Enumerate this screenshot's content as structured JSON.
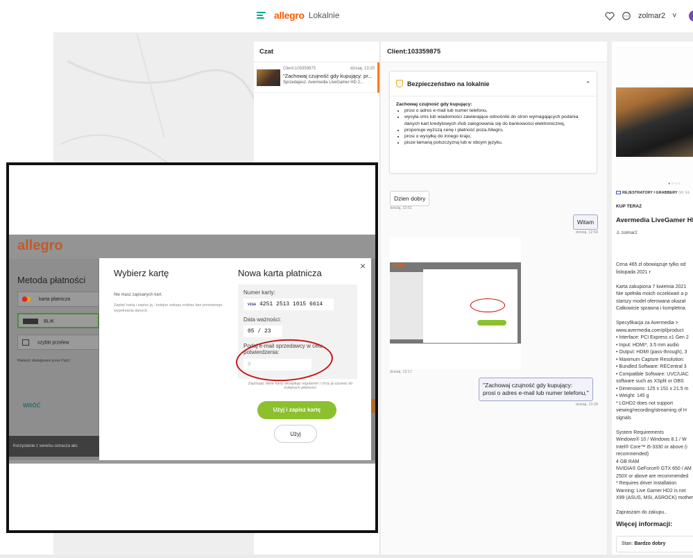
{
  "header": {
    "brand": "allegro",
    "brand_sub": "Lokalnie",
    "username": "zolmar2",
    "user_chevron": "˅"
  },
  "chat_list": {
    "title": "Czat",
    "item": {
      "client": "Client:103359875",
      "time": "dzisiaj, 13:20",
      "preview": "\"Zachowaj czujność gdy kupujący: pr...",
      "seller_label": "Sprzedajesz:",
      "seller_item": "Avermedia LiveGamer HD 2..."
    }
  },
  "conversation": {
    "title": "Client:103359875",
    "safety": {
      "heading": "Bezpieczeństwo na lokalnie",
      "chevron": "⌃",
      "intro": "Zachowaj czujność gdy kupujący:",
      "items": [
        "prosi o adres e-mail lub numer telefonu,",
        "wysyła sms lub wiadomości zawierające odnośniki do stron wymagających podania danych kart kredytowych i/lub zalogowania się do bankowości elektronicznej,",
        "proponuje wyższą cenę i płatność poza Allegro,",
        "prosi o wysyłkę do innego kraju,",
        "pisze łamaną polszczyzną lub w obcym języku."
      ]
    },
    "msg1": {
      "text": "Dzien dobry",
      "time": "dzisiaj, 12:51"
    },
    "msg2": {
      "text": "Witam",
      "time": "dzisiaj, 12:59"
    },
    "msg3": {
      "time": "dzisiaj, 13:17"
    },
    "msg4": {
      "line1": "\"Zachowaj czujność gdy kupujący:",
      "line2": "prosi o adres e-mail lub numer telefonu,\"",
      "time": "dzisiaj, 13:20"
    },
    "mini_logo": "allegro"
  },
  "product": {
    "category": "REJESTRATORY I GRABBERY",
    "category_extra": "(W: EL",
    "dots": "●○○○",
    "buy_now": "KUP TERAZ",
    "title": "Avermedia LiveGamer HI",
    "seller": "zolmar2",
    "description": "Cena 465 zł obowiązuje tylko od\nlistopada 2021 r\n\nKarta zakupiona 7 kwietnia 2021\nNie spełniła moich oczekiwań a p\nstarszy model oferowana okazał\nCałkowicie sprawna i kompletna.\n\nSpecyfikacja za Avermedia >\nwww.avermedia.com/pl/product\n• Interface: PCI Express x1 Gen 2\n• Input: HDMI*, 3.5 mm audio\n• Output: HDMI (pass-through), 3\n• Maximum Capture Resolution:\n• Bundled Software: RECentral 3\n• Compatible Software: UVC/UAC\nsoftware such as XSplit or OBS\n• Dimensions: 125 x 151 x 21.5 m\n• Weight: 145 g\n* LGHD2 does not support\nviewing/recording/streaming of H\nsignals\n\nSystem Requirements\nWindows® 10 / Windows 8.1 / W\nIntel® Core™ i5-3330 or above (i\nrecommended)\n4 GB RAM\nNVIDIA® GeForce® GTX 650 / AM\n250X or above are recommended\n* Requires driver installation\nWarning: Live Gamer HD2 is not\nX99 (ASUS, MSI, ASROCK) mother\n\nZapraszam do zakupu..",
    "more_info": "Więcej informacji:",
    "condition_label": "Stan:",
    "condition_value": "Bardzo dobry"
  },
  "overlay": {
    "logo": "allegro",
    "method_title": "Metoda płatności",
    "opt_card": "karta płatnicza",
    "opt_blik": "BLIK",
    "opt_transfer": "szybki przelew",
    "payu_note": "Płatność obsługiwane przez PayU.",
    "back": "WRÓĆ",
    "footer_text": "Korzystanie z serwisu oznacza akc",
    "close": "×",
    "choose_card": "Wybierz kartę",
    "no_saved": "Nie masz zapisanych kart.",
    "info": "Zapłać kartą i zapisz ją - kolejne zakupy zrobisz bez ponownego wypełniania danych.",
    "new_card": "Nowa karta płatnicza",
    "card_number_label": "Numer karty:",
    "card_brand": "VISA",
    "card_number": "4251 2513 1015 6614",
    "expiry_label": "Data ważności:",
    "expiry": "05 / 23",
    "email_label_1": "Podaj e-mail sprzedawcy w celu",
    "email_label_2": "potwierdzenia:",
    "email_placeholder": "0",
    "terms": "Zapisując dane karty akceptuję regulamin i chcę ją używać do kolejnych płatności",
    "save_button": "Użyj i zapisz kartę",
    "use_button": "Użyj"
  }
}
